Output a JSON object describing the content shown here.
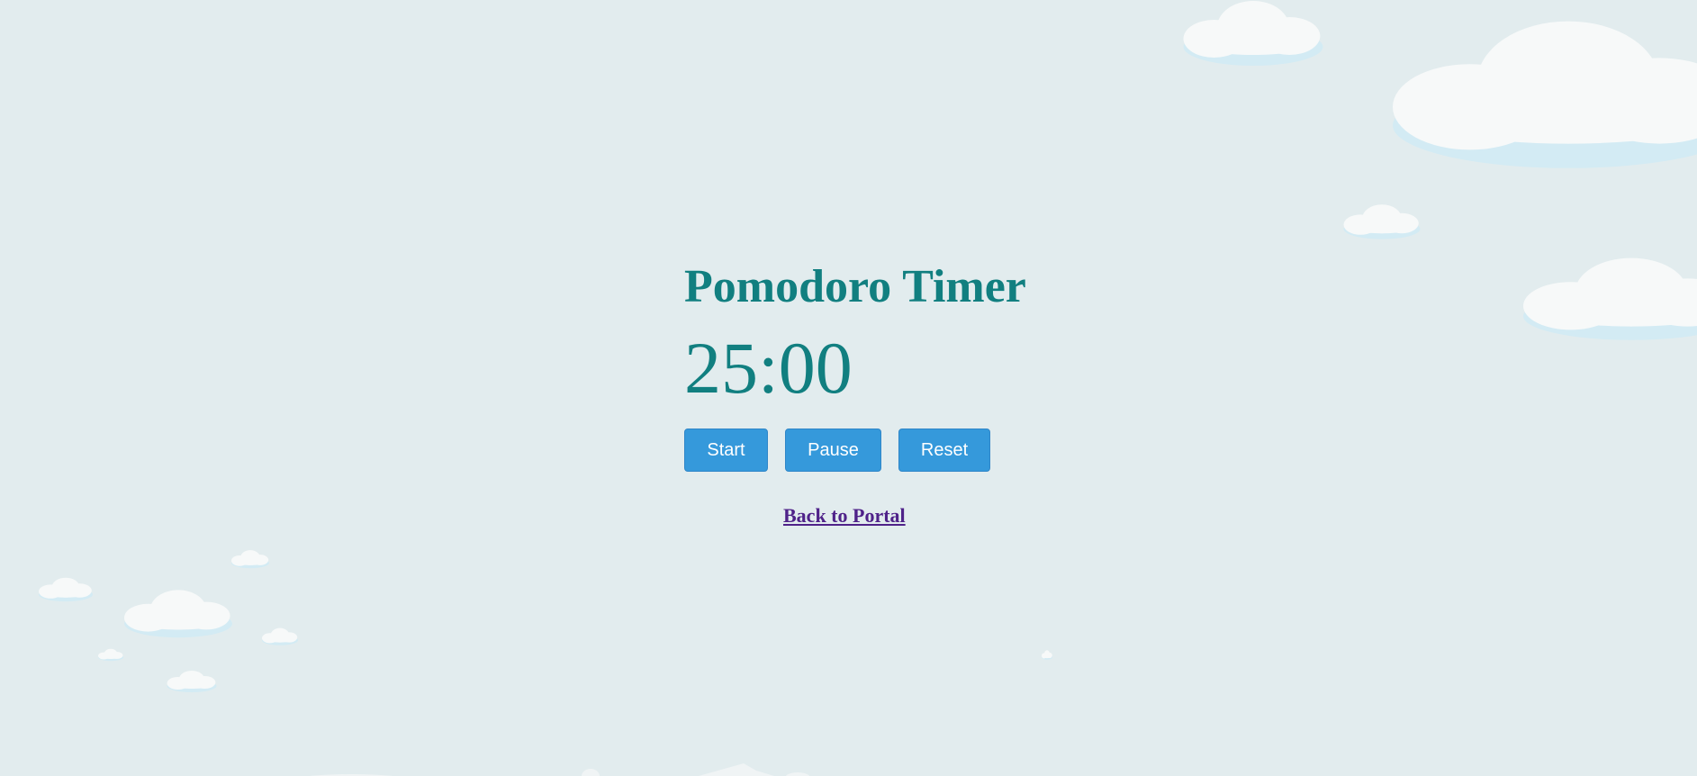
{
  "page": {
    "title": "Pomodoro Timer",
    "timer_display": "25:00"
  },
  "controls": {
    "start_label": "Start",
    "pause_label": "Pause",
    "reset_label": "Reset"
  },
  "nav": {
    "back_link_label": "Back to Portal"
  },
  "colors": {
    "background": "#e2ecee",
    "title_teal": "#117f80",
    "button_blue": "#3599db",
    "link_purple": "#4f2289",
    "cloud_white": "#f7f9f9",
    "cloud_shade": "#d3ebf4"
  },
  "decorations": {
    "background_icon": "cloud-icon"
  }
}
